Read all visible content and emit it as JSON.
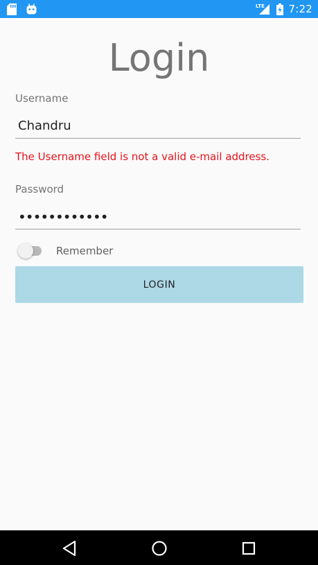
{
  "status_bar": {
    "time": "7:22",
    "network_label": "LTE",
    "left_icons": [
      "sd-card-icon",
      "android-icon"
    ],
    "color": "#2196f3"
  },
  "page": {
    "title": "Login"
  },
  "username": {
    "label": "Username",
    "value": "Chandru",
    "error": "The Username field is not a valid e-mail address."
  },
  "password": {
    "label": "Password",
    "value": "••••••••••••"
  },
  "remember": {
    "label": "Remember",
    "checked": false
  },
  "login_button": {
    "label": "LOGIN",
    "color": "#add8e6"
  },
  "nav_bar": {
    "buttons": [
      "back-icon",
      "home-icon",
      "recents-icon"
    ]
  }
}
